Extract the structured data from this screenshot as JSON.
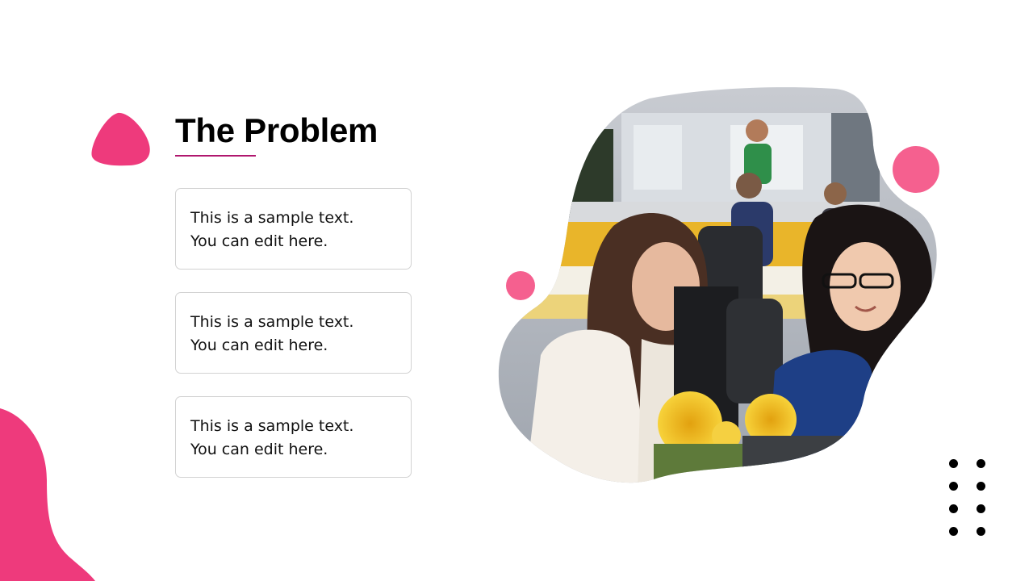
{
  "slide": {
    "title": "The Problem",
    "accent_color": "#ee3a7c",
    "cards": [
      {
        "line1": "This is a sample text.",
        "line2": "You can edit here."
      },
      {
        "line1": "This is a sample text.",
        "line2": "You can edit here."
      },
      {
        "line1": "This is a sample text.",
        "line2": "You can edit here."
      }
    ],
    "photo_icon": "office-photo"
  }
}
